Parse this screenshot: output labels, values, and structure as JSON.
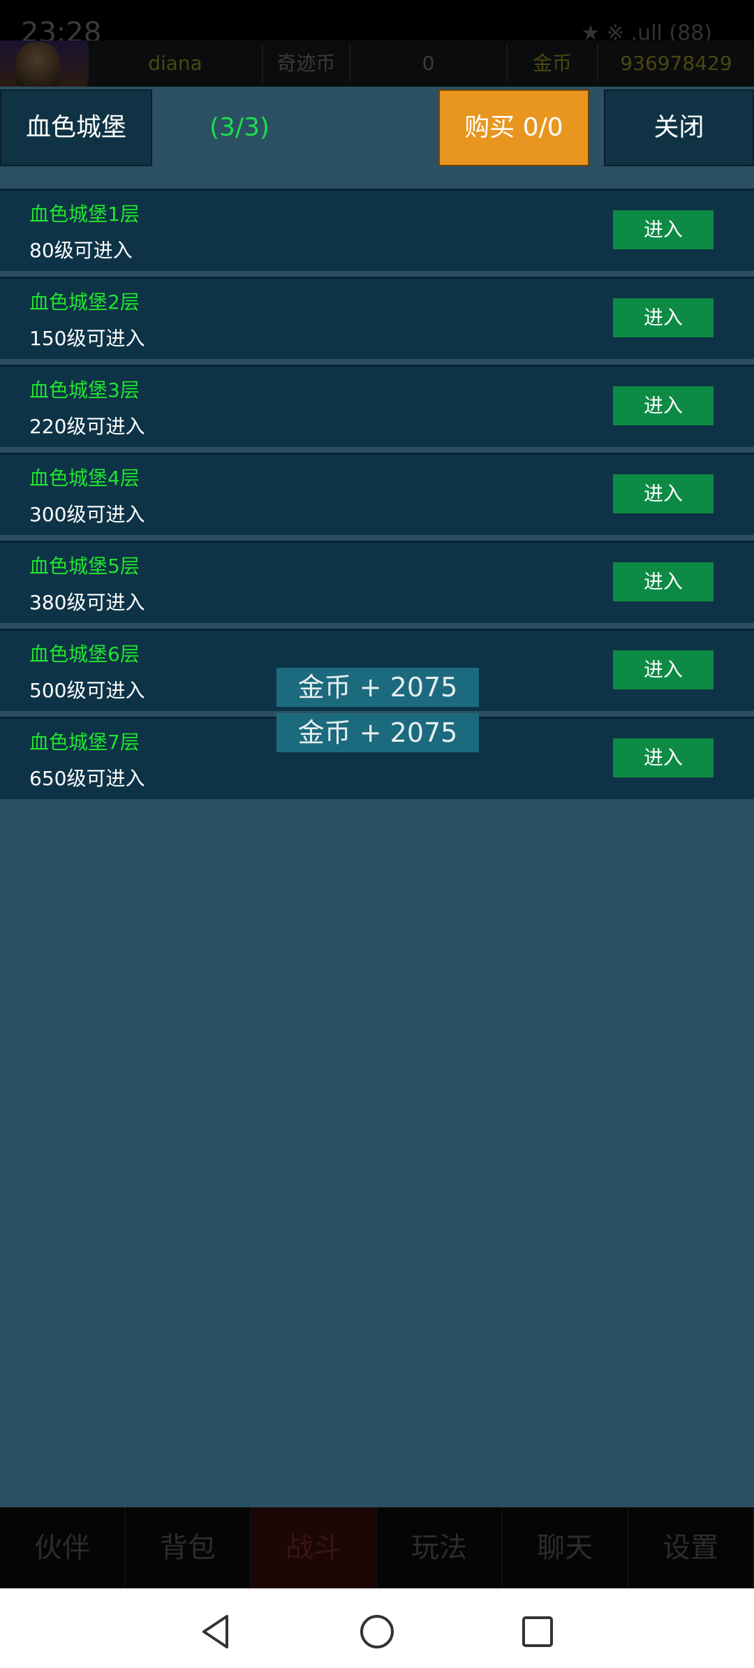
{
  "status_bar": {
    "time": "23:28",
    "icons_text": "★ ※ .ull (88)"
  },
  "top_info": {
    "username": "diana",
    "currency1_label": "奇迹币",
    "currency1_value": "0",
    "currency2_label": "金币",
    "currency2_value": "936978429"
  },
  "panel": {
    "title": "血色城堡",
    "count": "(3/3)",
    "buy_label": "购买 0/0",
    "close_label": "关闭"
  },
  "floors": [
    {
      "name": "血色城堡1层",
      "requirement": "80级可进入",
      "button": "进入"
    },
    {
      "name": "血色城堡2层",
      "requirement": "150级可进入",
      "button": "进入"
    },
    {
      "name": "血色城堡3层",
      "requirement": "220级可进入",
      "button": "进入"
    },
    {
      "name": "血色城堡4层",
      "requirement": "300级可进入",
      "button": "进入"
    },
    {
      "name": "血色城堡5层",
      "requirement": "380级可进入",
      "button": "进入"
    },
    {
      "name": "血色城堡6层",
      "requirement": "500级可进入",
      "button": "进入"
    },
    {
      "name": "血色城堡7层",
      "requirement": "650级可进入",
      "button": "进入"
    }
  ],
  "toasts": [
    "金币 + 2075",
    "金币 + 2075"
  ],
  "bottom_nav": [
    "伙伴",
    "背包",
    "战斗",
    "玩法",
    "聊天",
    "设置"
  ],
  "bottom_nav_active": "战斗",
  "colors": {
    "background": "#2c5063",
    "row_bg": "#0e3347",
    "floor_name": "#1fe52d",
    "enter_button": "#0d8a44",
    "buy_button": "#e8961f",
    "count_text": "#19e04b",
    "toast_bg": "#1b6a7e"
  }
}
